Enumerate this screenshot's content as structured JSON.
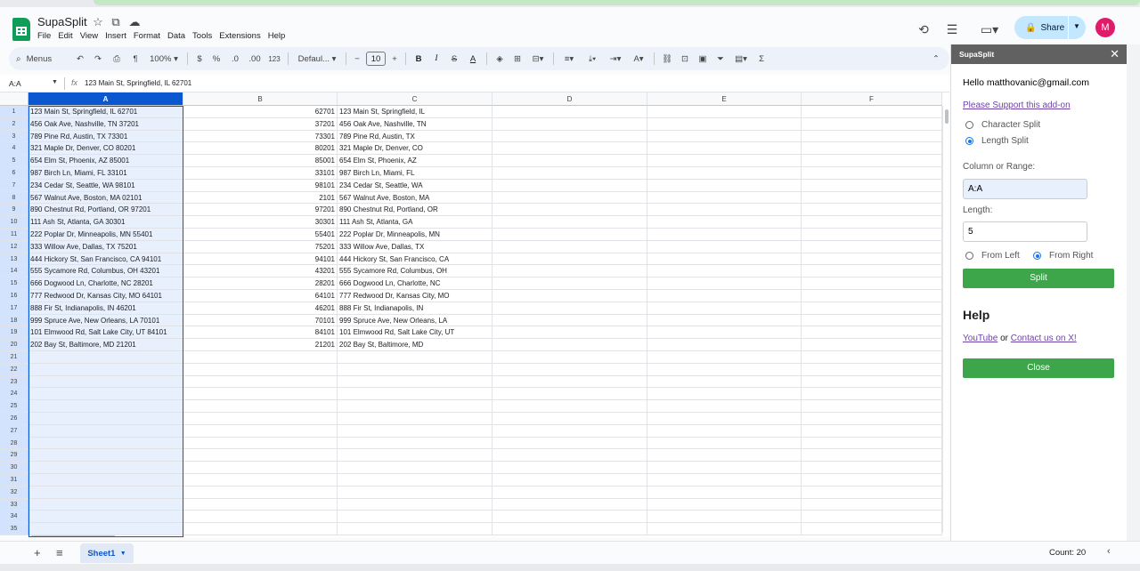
{
  "app": {
    "title": "SupaSplit",
    "menu": [
      "File",
      "Edit",
      "View",
      "Insert",
      "Format",
      "Data",
      "Tools",
      "Extensions",
      "Help"
    ],
    "share_label": "Share",
    "avatar_letter": "M"
  },
  "toolbar": {
    "menus_label": "Menus",
    "zoom": "100%",
    "currency": "$",
    "percent": "%",
    "dec_decrease": ".0",
    "dec_increase": ".00",
    "number_format": "123",
    "font": "Defaul...",
    "font_size": "10",
    "bold": "B",
    "italic": "I",
    "text_color": "A"
  },
  "formula_bar": {
    "name_box": "A:A",
    "fx": "fx",
    "content": "123 Main St, Springfield, IL 62701"
  },
  "grid": {
    "columns": [
      "A",
      "B",
      "C",
      "D",
      "E",
      "F"
    ],
    "row_numbers": [
      "1",
      "2",
      "3",
      "4",
      "5",
      "6",
      "7",
      "8",
      "9",
      "10",
      "11",
      "12",
      "13",
      "14",
      "15",
      "16",
      "17",
      "18",
      "19",
      "20",
      "21",
      "22",
      "23",
      "24",
      "25",
      "26",
      "27",
      "28",
      "29",
      "30",
      "31",
      "32",
      "33",
      "34",
      "35"
    ],
    "rows": [
      {
        "a": "123 Main St, Springfield, IL 62701",
        "b": "62701",
        "c": "123 Main St, Springfield, IL"
      },
      {
        "a": "456 Oak Ave, Nashville, TN 37201",
        "b": "37201",
        "c": "456 Oak Ave, Nashville, TN"
      },
      {
        "a": "789 Pine Rd, Austin, TX 73301",
        "b": "73301",
        "c": "789 Pine Rd, Austin, TX"
      },
      {
        "a": "321 Maple Dr, Denver, CO 80201",
        "b": "80201",
        "c": "321 Maple Dr, Denver, CO"
      },
      {
        "a": "654 Elm St, Phoenix, AZ 85001",
        "b": "85001",
        "c": "654 Elm St, Phoenix, AZ"
      },
      {
        "a": "987 Birch Ln, Miami, FL 33101",
        "b": "33101",
        "c": "987 Birch Ln, Miami, FL"
      },
      {
        "a": "234 Cedar St, Seattle, WA 98101",
        "b": "98101",
        "c": "234 Cedar St, Seattle, WA"
      },
      {
        "a": "567 Walnut Ave, Boston, MA 02101",
        "b": "2101",
        "c": "567 Walnut Ave, Boston, MA"
      },
      {
        "a": "890 Chestnut Rd, Portland, OR 97201",
        "b": "97201",
        "c": "890 Chestnut Rd, Portland, OR"
      },
      {
        "a": "111 Ash St, Atlanta, GA 30301",
        "b": "30301",
        "c": "111 Ash St, Atlanta, GA"
      },
      {
        "a": "222 Poplar Dr, Minneapolis, MN 55401",
        "b": "55401",
        "c": "222 Poplar Dr, Minneapolis, MN"
      },
      {
        "a": "333 Willow Ave, Dallas, TX 75201",
        "b": "75201",
        "c": "333 Willow Ave, Dallas, TX"
      },
      {
        "a": "444 Hickory St, San Francisco, CA 94101",
        "b": "94101",
        "c": "444 Hickory St, San Francisco, CA"
      },
      {
        "a": "555 Sycamore Rd, Columbus, OH 43201",
        "b": "43201",
        "c": "555 Sycamore Rd, Columbus, OH"
      },
      {
        "a": "666 Dogwood Ln, Charlotte, NC 28201",
        "b": "28201",
        "c": "666 Dogwood Ln, Charlotte, NC"
      },
      {
        "a": "777 Redwood Dr, Kansas City, MO 64101",
        "b": "64101",
        "c": "777 Redwood Dr, Kansas City, MO"
      },
      {
        "a": "888 Fir St, Indianapolis, IN 46201",
        "b": "46201",
        "c": "888 Fir St, Indianapolis, IN"
      },
      {
        "a": "999 Spruce Ave, New Orleans, LA 70101",
        "b": "70101",
        "c": "999 Spruce Ave, New Orleans, LA"
      },
      {
        "a": "101 Elmwood Rd, Salt Lake City, UT 84101",
        "b": "84101",
        "c": "101 Elmwood Rd, Salt Lake City, UT"
      },
      {
        "a": "202 Bay St, Baltimore, MD 21201",
        "b": "21201",
        "c": "202 Bay St, Baltimore, MD"
      }
    ]
  },
  "bottom": {
    "sheet_tab": "Sheet1",
    "count": "Count: 20"
  },
  "sidebar": {
    "title": "SupaSplit",
    "hello": "Hello matthovanic@gmail.com",
    "support_link": "Please Support this add-on",
    "mode_options": [
      "Character Split",
      "Length Split"
    ],
    "mode_selected": "Length Split",
    "range_label": "Column or Range:",
    "range_value": "A:A",
    "length_label": "Length:",
    "length_value": "5",
    "direction_options": [
      "From Left",
      "From Right"
    ],
    "direction_selected": "From Right",
    "split_button": "Split",
    "help_heading": "Help",
    "youtube_link": "YouTube",
    "or_text": "or",
    "contact_link": "Contact us on X!",
    "close_button": "Close"
  },
  "colors": {
    "accent": "#0b57d0",
    "sidebar_button": "#3ea64a",
    "sidebar_header": "#616161",
    "link": "#6f42a8"
  }
}
